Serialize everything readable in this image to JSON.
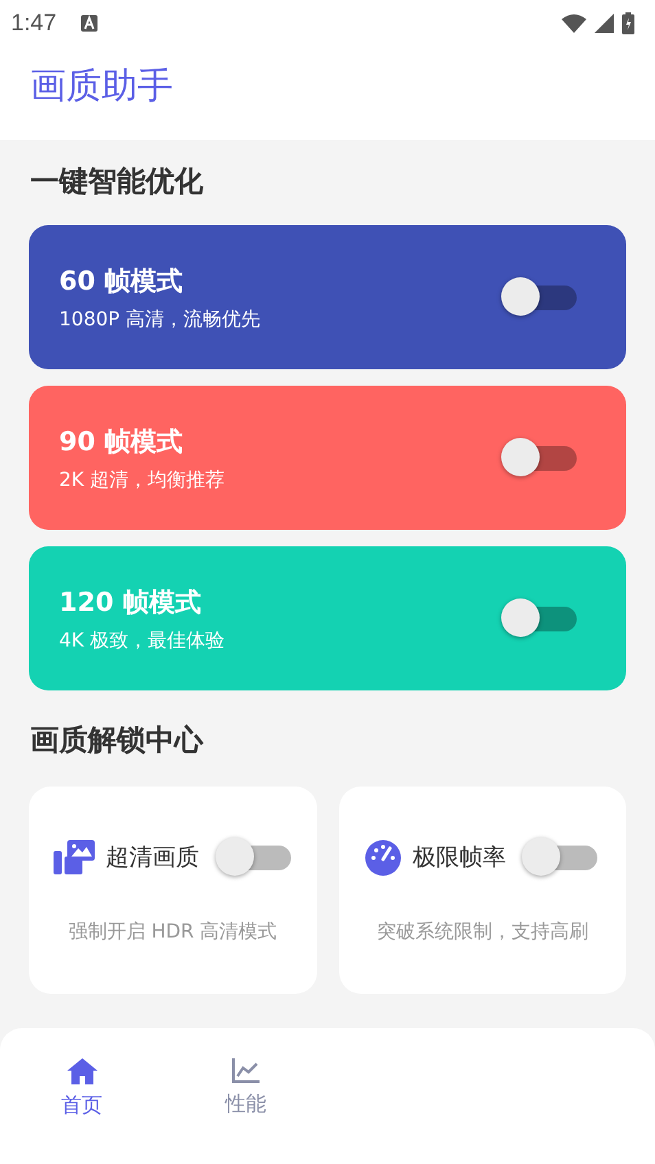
{
  "status_bar": {
    "time": "1:47"
  },
  "app_bar": {
    "title": "画质助手"
  },
  "sections": [
    {
      "title": "一键智能优化"
    },
    {
      "title": "画质解锁中心"
    }
  ],
  "modes": [
    {
      "title": "60 帧模式",
      "subtitle": "1080P 高清，流畅优先",
      "color": "#3f51b5",
      "on": false
    },
    {
      "title": "90 帧模式",
      "subtitle": "2K 超清，均衡推荐",
      "color": "#ff6461",
      "on": false
    },
    {
      "title": "120 帧模式",
      "subtitle": "4K 极致，最佳体验",
      "color": "#14d2b2",
      "on": false
    }
  ],
  "features": [
    {
      "kind": "images",
      "label": "超清画质",
      "description": "强制开启 HDR 高清模式",
      "on": false
    },
    {
      "kind": "gauge",
      "label": "极限帧率",
      "description": "突破系统限制，支持高刷",
      "on": false
    }
  ],
  "nav": [
    {
      "kind": "home",
      "label": "首页",
      "selected": true
    },
    {
      "kind": "chart",
      "label": "性能",
      "selected": false
    }
  ]
}
